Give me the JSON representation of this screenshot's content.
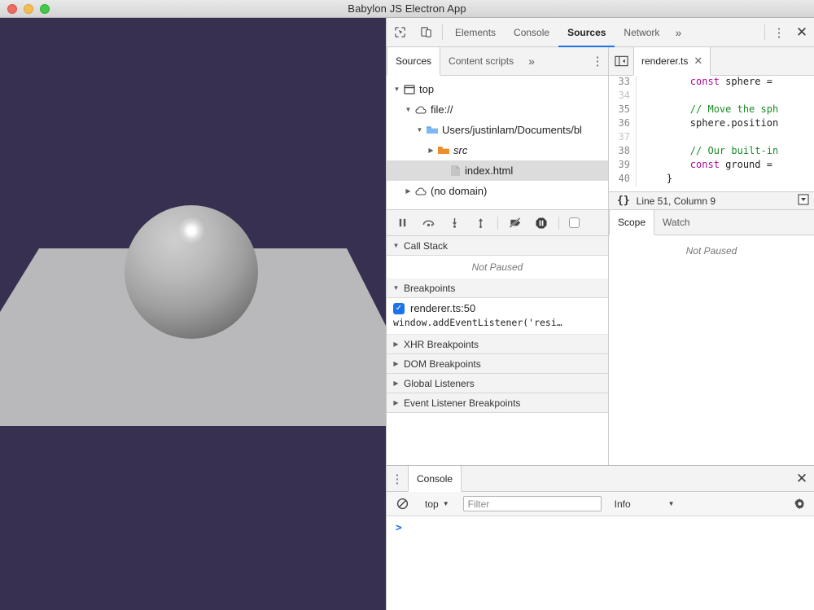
{
  "window": {
    "title": "Babylon JS Electron App",
    "traffic_lights": [
      "close",
      "minimize",
      "zoom"
    ]
  },
  "render": {
    "background_color": "#373050",
    "ground_color": "#b9b9bb",
    "sphere_highlight_color": "#ffffff"
  },
  "devtools": {
    "main_tabs": [
      {
        "label": "Elements",
        "active": false
      },
      {
        "label": "Console",
        "active": false
      },
      {
        "label": "Sources",
        "active": true
      },
      {
        "label": "Network",
        "active": false
      }
    ],
    "more_tabs_label": "»",
    "inspect_icon": "inspect-element-icon",
    "device_icon": "device-toolbar-icon",
    "kebab_label": "⋮",
    "close_label": "✕",
    "sources": {
      "navigator_tabs": [
        {
          "label": "Sources",
          "active": true
        },
        {
          "label": "Content scripts",
          "active": false
        }
      ],
      "navigator_more": "»",
      "navigator_kebab": "⋮",
      "panel_toggle_icon": "show-navigator-icon",
      "open_files": [
        {
          "label": "renderer.ts",
          "close": "✕",
          "active": true
        }
      ],
      "tree": [
        {
          "label": "top",
          "icon": "frame-icon",
          "indent": 0,
          "twisty": "▼",
          "selected": false,
          "italic": false
        },
        {
          "label": "file://",
          "icon": "cloud-icon",
          "indent": 1,
          "twisty": "▼",
          "selected": false,
          "italic": false
        },
        {
          "label": "Users/justinlam/Documents/bl",
          "icon": "folder-blue-icon",
          "indent": 2,
          "twisty": "▼",
          "selected": false,
          "italic": false
        },
        {
          "label": "src",
          "icon": "folder-orange-icon",
          "indent": 3,
          "twisty": "▶",
          "selected": false,
          "italic": true
        },
        {
          "label": "index.html",
          "icon": "file-icon",
          "indent": 4,
          "twisty": "",
          "selected": true,
          "italic": false
        },
        {
          "label": "(no domain)",
          "icon": "cloud-icon",
          "indent": 1,
          "twisty": "▶",
          "selected": false,
          "italic": false
        }
      ],
      "code_lines": [
        {
          "num": "33",
          "dim": false,
          "segments": [
            {
              "t": "        ",
              "c": ""
            },
            {
              "t": "const",
              "c": "kw2"
            },
            {
              "t": " sphere = ",
              "c": ""
            }
          ]
        },
        {
          "num": "34",
          "dim": true,
          "segments": []
        },
        {
          "num": "35",
          "dim": false,
          "segments": [
            {
              "t": "        ",
              "c": ""
            },
            {
              "t": "// Move the sph",
              "c": "cm"
            }
          ]
        },
        {
          "num": "36",
          "dim": false,
          "segments": [
            {
              "t": "        sphere.position",
              "c": ""
            }
          ]
        },
        {
          "num": "37",
          "dim": true,
          "segments": []
        },
        {
          "num": "38",
          "dim": false,
          "segments": [
            {
              "t": "        ",
              "c": ""
            },
            {
              "t": "// Our built-in",
              "c": "cm"
            }
          ]
        },
        {
          "num": "39",
          "dim": false,
          "segments": [
            {
              "t": "        ",
              "c": ""
            },
            {
              "t": "const",
              "c": "kw2"
            },
            {
              "t": " ground = ",
              "c": ""
            }
          ]
        },
        {
          "num": "40",
          "dim": false,
          "segments": [
            {
              "t": "    }",
              "c": ""
            }
          ]
        }
      ],
      "status": {
        "braces_icon": "{}",
        "cursor_position": "Line 51, Column 9",
        "pretty_print_icon": "format-source-icon"
      }
    },
    "debugger": {
      "toolbar": [
        {
          "name": "resume-pause-button",
          "glyph": "pause"
        },
        {
          "name": "step-over-button",
          "glyph": "step-over"
        },
        {
          "name": "step-into-button",
          "glyph": "step-into"
        },
        {
          "name": "step-out-button",
          "glyph": "step-out"
        },
        {
          "name": "deactivate-breakpoints-button",
          "glyph": "deactivate"
        },
        {
          "name": "pause-on-exceptions-button",
          "glyph": "pause-circle"
        }
      ],
      "pause_on_caught_checkbox": false,
      "sections": [
        {
          "label": "Call Stack",
          "twisty": "▼",
          "expanded": true,
          "empty_text": "Not Paused"
        },
        {
          "label": "Breakpoints",
          "twisty": "▼",
          "expanded": true
        },
        {
          "label": "XHR Breakpoints",
          "twisty": "▶",
          "expanded": false
        },
        {
          "label": "DOM Breakpoints",
          "twisty": "▶",
          "expanded": false
        },
        {
          "label": "Global Listeners",
          "twisty": "▶",
          "expanded": false
        },
        {
          "label": "Event Listener Breakpoints",
          "twisty": "▶",
          "expanded": false
        }
      ],
      "breakpoints": [
        {
          "checked": true,
          "location": "renderer.ts:50",
          "source": "window.addEventListener('resi…"
        }
      ],
      "side_tabs": [
        {
          "label": "Scope",
          "active": true
        },
        {
          "label": "Watch",
          "active": false
        }
      ],
      "side_empty_text": "Not Paused"
    },
    "drawer": {
      "kebab": "⋮",
      "tabs": [
        {
          "label": "Console",
          "active": true
        }
      ],
      "close": "✕",
      "toolbar": {
        "clear_icon": "clear-console-icon",
        "context": "top",
        "context_caret": "▼",
        "filter_placeholder": "Filter",
        "filter_value": "",
        "level": "Info",
        "level_caret": "▼",
        "settings_icon": "gear-icon"
      },
      "prompt": ">"
    }
  },
  "colors": {
    "accent": "#1a73e8",
    "chrome_bg": "#f3f3f3",
    "border": "#cdcdcd",
    "comment_green": "#1a8a26",
    "keyword_purple": "#aa0d91"
  }
}
